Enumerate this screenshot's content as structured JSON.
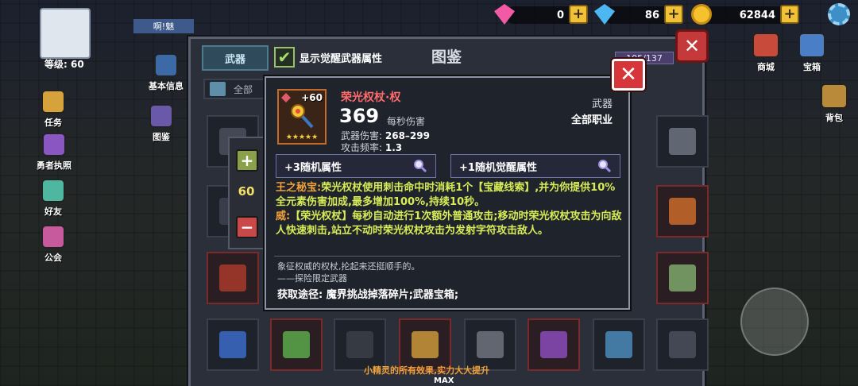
{
  "hud": {
    "gems": "0",
    "blue_gems": "86",
    "coins": "62844",
    "level": "等级: 60",
    "player_name": "啊!魅"
  },
  "left_menu": [
    {
      "label": "基本信息",
      "icon": "info-icon",
      "color": "#3b6aa6"
    },
    {
      "label": "任务",
      "icon": "task-icon",
      "color": "#d6a23b"
    },
    {
      "label": "勇者执照",
      "icon": "license-icon",
      "color": "#8a56c2"
    },
    {
      "label": "好友",
      "icon": "friends-icon",
      "color": "#4fb7a0"
    },
    {
      "label": "公会",
      "icon": "guild-icon",
      "color": "#c75a9c"
    }
  ],
  "right_menu": [
    {
      "label": "商城",
      "icon": "shop-icon",
      "color": "#c74a3a"
    },
    {
      "label": "宝箱",
      "icon": "chest-icon",
      "color": "#4a7ec7"
    },
    {
      "label": "背包",
      "icon": "bag-icon",
      "color": "#b88a3a"
    }
  ],
  "codex": {
    "title": "图鉴",
    "tab_label": "武器",
    "toggle_label": "显示觉醒武器属性",
    "progress": "105/137",
    "filter_all": "全部",
    "nav_label": "图鉴"
  },
  "stepper": {
    "value": "60"
  },
  "weapon": {
    "level": "+60",
    "stars": "★★★★★",
    "name": "荣光权杖·权",
    "dps": "369",
    "dps_label": "每秒伤害",
    "damage_label": "武器伤害:",
    "damage_value": "268–299",
    "rate_label": "攻击频率:",
    "rate_value": "1.3",
    "category": "武器",
    "class": "全部职业",
    "random_attr_label": "+3随机属性",
    "awaken_attr_label": "+1随机觉醒属性",
    "skill1_name": "王之秘宝:",
    "skill1_text": "荣光权杖使用刺击命中时消耗1个【宝藏线索】,并为你提供10%全元素伤害加成,最多增加100%,持续10秒。",
    "skill2_name": "威:",
    "skill2_text": "【荣光权杖】每秒自动进行1次额外普通攻击;移动时荣光权杖攻击为向敌人快速刺击,站立不动时荣光权杖攻击为发射字符攻击敌人。",
    "flavor_line1": "象征权威的权杖,抡起来还挺顺手的。",
    "flavor_line2": "——探险限定武器",
    "obtain": "获取途径: 魔界挑战掉落碎片;武器宝箱;"
  },
  "bottom": {
    "hint": "小精灵的所有效果,实力大大提升",
    "max": "MAX"
  },
  "colors": {
    "weapon_name": "#ff6b6b",
    "skill_key": "#f0a23a",
    "skill_text": "#d7ec57",
    "close_red": "#d6363a"
  }
}
